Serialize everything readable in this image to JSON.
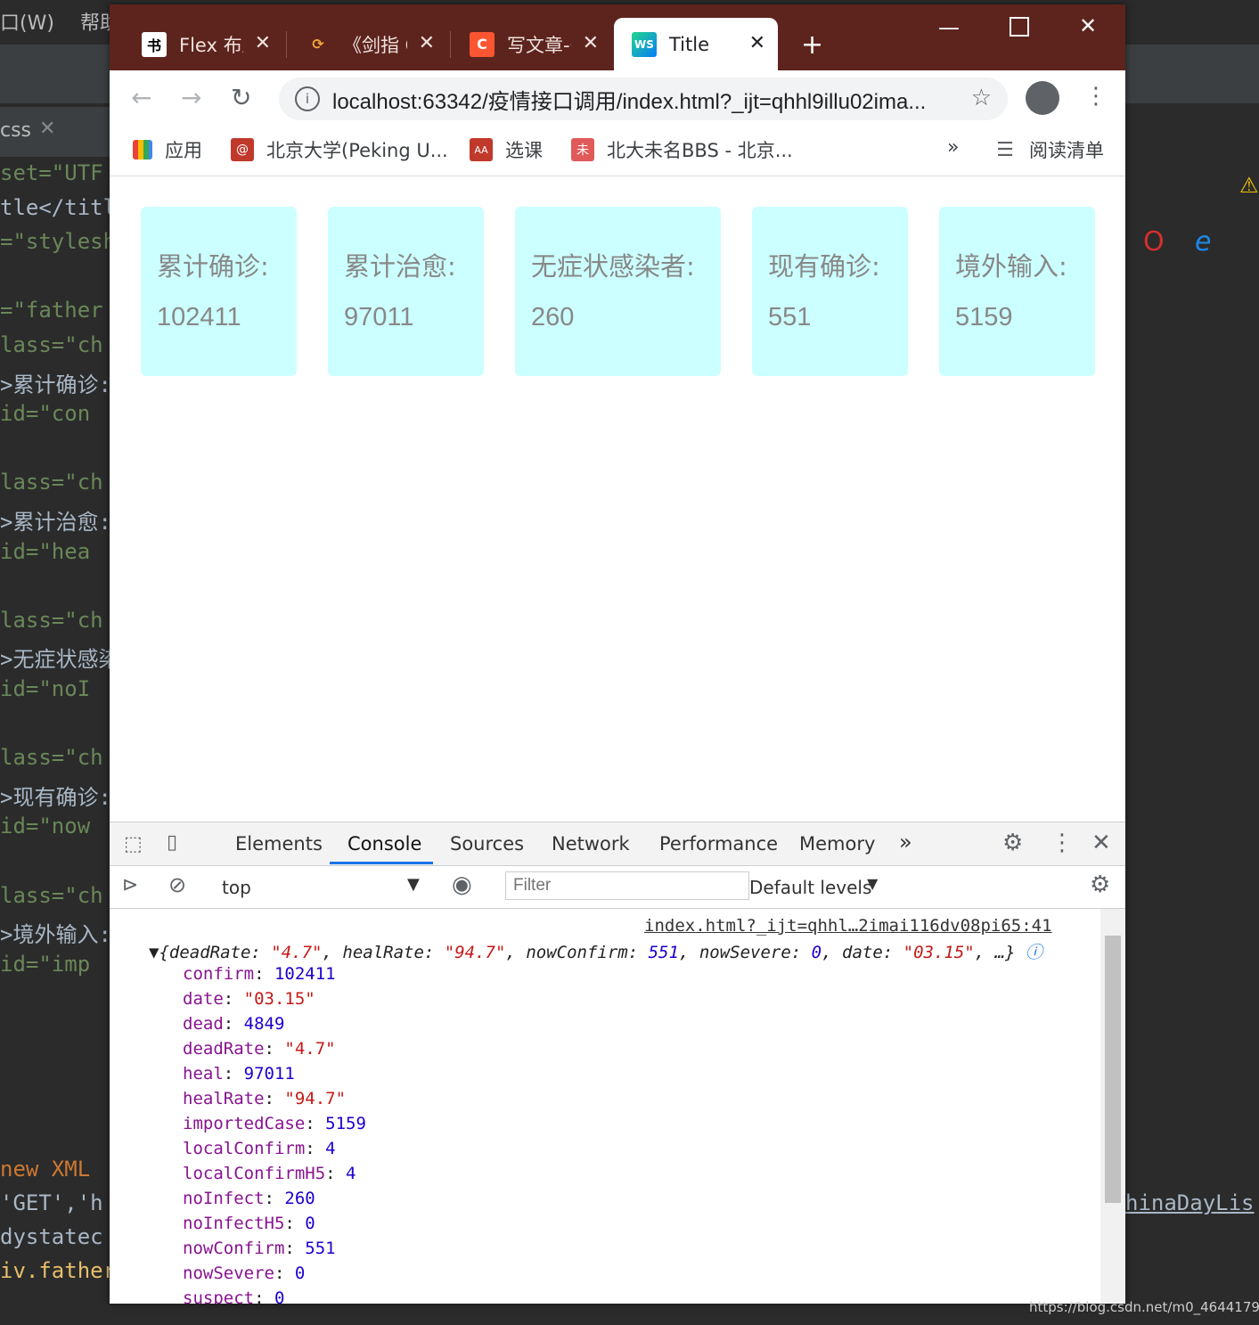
{
  "ide": {
    "menu": [
      "口(W)",
      "帮助"
    ],
    "tab_label": "css",
    "code_lines": [
      "set=\"UTF",
      "tle</titl",
      "=\"stylesh",
      "",
      "=\"father",
      "lass=\"ch",
      ">累计确诊:",
      " id=\"con",
      "",
      "lass=\"ch",
      ">累计治愈:",
      " id=\"hea",
      "",
      "lass=\"ch",
      ">无症状感染",
      " id=\"noI",
      "",
      "lass=\"ch",
      ">现有确诊:",
      " id=\"now",
      "",
      "lass=\"ch",
      ">境外输入:",
      " id=\"imp"
    ],
    "bottom_lines": [
      " new XML",
      "'GET','h",
      "dystatec",
      "iv.father"
    ],
    "right_code": "hinaDayLis"
  },
  "browser": {
    "tabs": [
      {
        "title": "Flex 布局",
        "favicon": "书"
      },
      {
        "title": "《剑指 Offer》",
        "favicon": "C"
      },
      {
        "title": "写文章-CSDN",
        "favicon": "C"
      },
      {
        "title": "Title",
        "favicon": "WS"
      }
    ],
    "new_tab": "+",
    "url": "localhost:63342/疫情接口调用/index.html?_ijt=qhhl9illu02ima...",
    "bookmarks": [
      {
        "label": "应用"
      },
      {
        "label": "北京大学(Peking U..."
      },
      {
        "label": "选课"
      },
      {
        "label": "北大未名BBS - 北京..."
      }
    ],
    "bookmarks_more": "»",
    "reading_list": "阅读清单"
  },
  "page": {
    "cards": [
      {
        "label": "累计确诊:",
        "value": "102411"
      },
      {
        "label": "累计治愈:",
        "value": "97011"
      },
      {
        "label": "无症状感染者:",
        "value": "260"
      },
      {
        "label": "现有确诊:",
        "value": "551"
      },
      {
        "label": "境外输入:",
        "value": "5159"
      }
    ],
    "card_color": "#ccffff"
  },
  "devtools": {
    "tabs": [
      "Elements",
      "Console",
      "Sources",
      "Network",
      "Performance",
      "Memory"
    ],
    "more": "»",
    "context": "top",
    "filter_placeholder": "Filter",
    "levels": "Default levels",
    "source_link": "index.html?_ijt=qhhl…2imai116dv08pi65:41",
    "summary": {
      "open": "{",
      "items": [
        {
          "k": "deadRate",
          "v": "\"4.7\"",
          "t": "str"
        },
        {
          "k": "healRate",
          "v": "\"94.7\"",
          "t": "str"
        },
        {
          "k": "nowConfirm",
          "v": "551",
          "t": "num"
        },
        {
          "k": "nowSevere",
          "v": "0",
          "t": "num"
        },
        {
          "k": "date",
          "v": "\"03.15\"",
          "t": "str"
        }
      ],
      "tail": "…}"
    },
    "properties": [
      {
        "k": "confirm",
        "v": "102411",
        "t": "num"
      },
      {
        "k": "date",
        "v": "\"03.15\"",
        "t": "str"
      },
      {
        "k": "dead",
        "v": "4849",
        "t": "num"
      },
      {
        "k": "deadRate",
        "v": "\"4.7\"",
        "t": "str"
      },
      {
        "k": "heal",
        "v": "97011",
        "t": "num"
      },
      {
        "k": "healRate",
        "v": "\"94.7\"",
        "t": "str"
      },
      {
        "k": "importedCase",
        "v": "5159",
        "t": "num"
      },
      {
        "k": "localConfirm",
        "v": "4",
        "t": "num"
      },
      {
        "k": "localConfirmH5",
        "v": "4",
        "t": "num"
      },
      {
        "k": "noInfect",
        "v": "260",
        "t": "num"
      },
      {
        "k": "noInfectH5",
        "v": "0",
        "t": "num"
      },
      {
        "k": "nowConfirm",
        "v": "551",
        "t": "num"
      },
      {
        "k": "nowSevere",
        "v": "0",
        "t": "num"
      },
      {
        "k": "suspect",
        "v": "0",
        "t": "num"
      }
    ]
  },
  "watermark": "https://blog.csdn.net/m0_46441797"
}
